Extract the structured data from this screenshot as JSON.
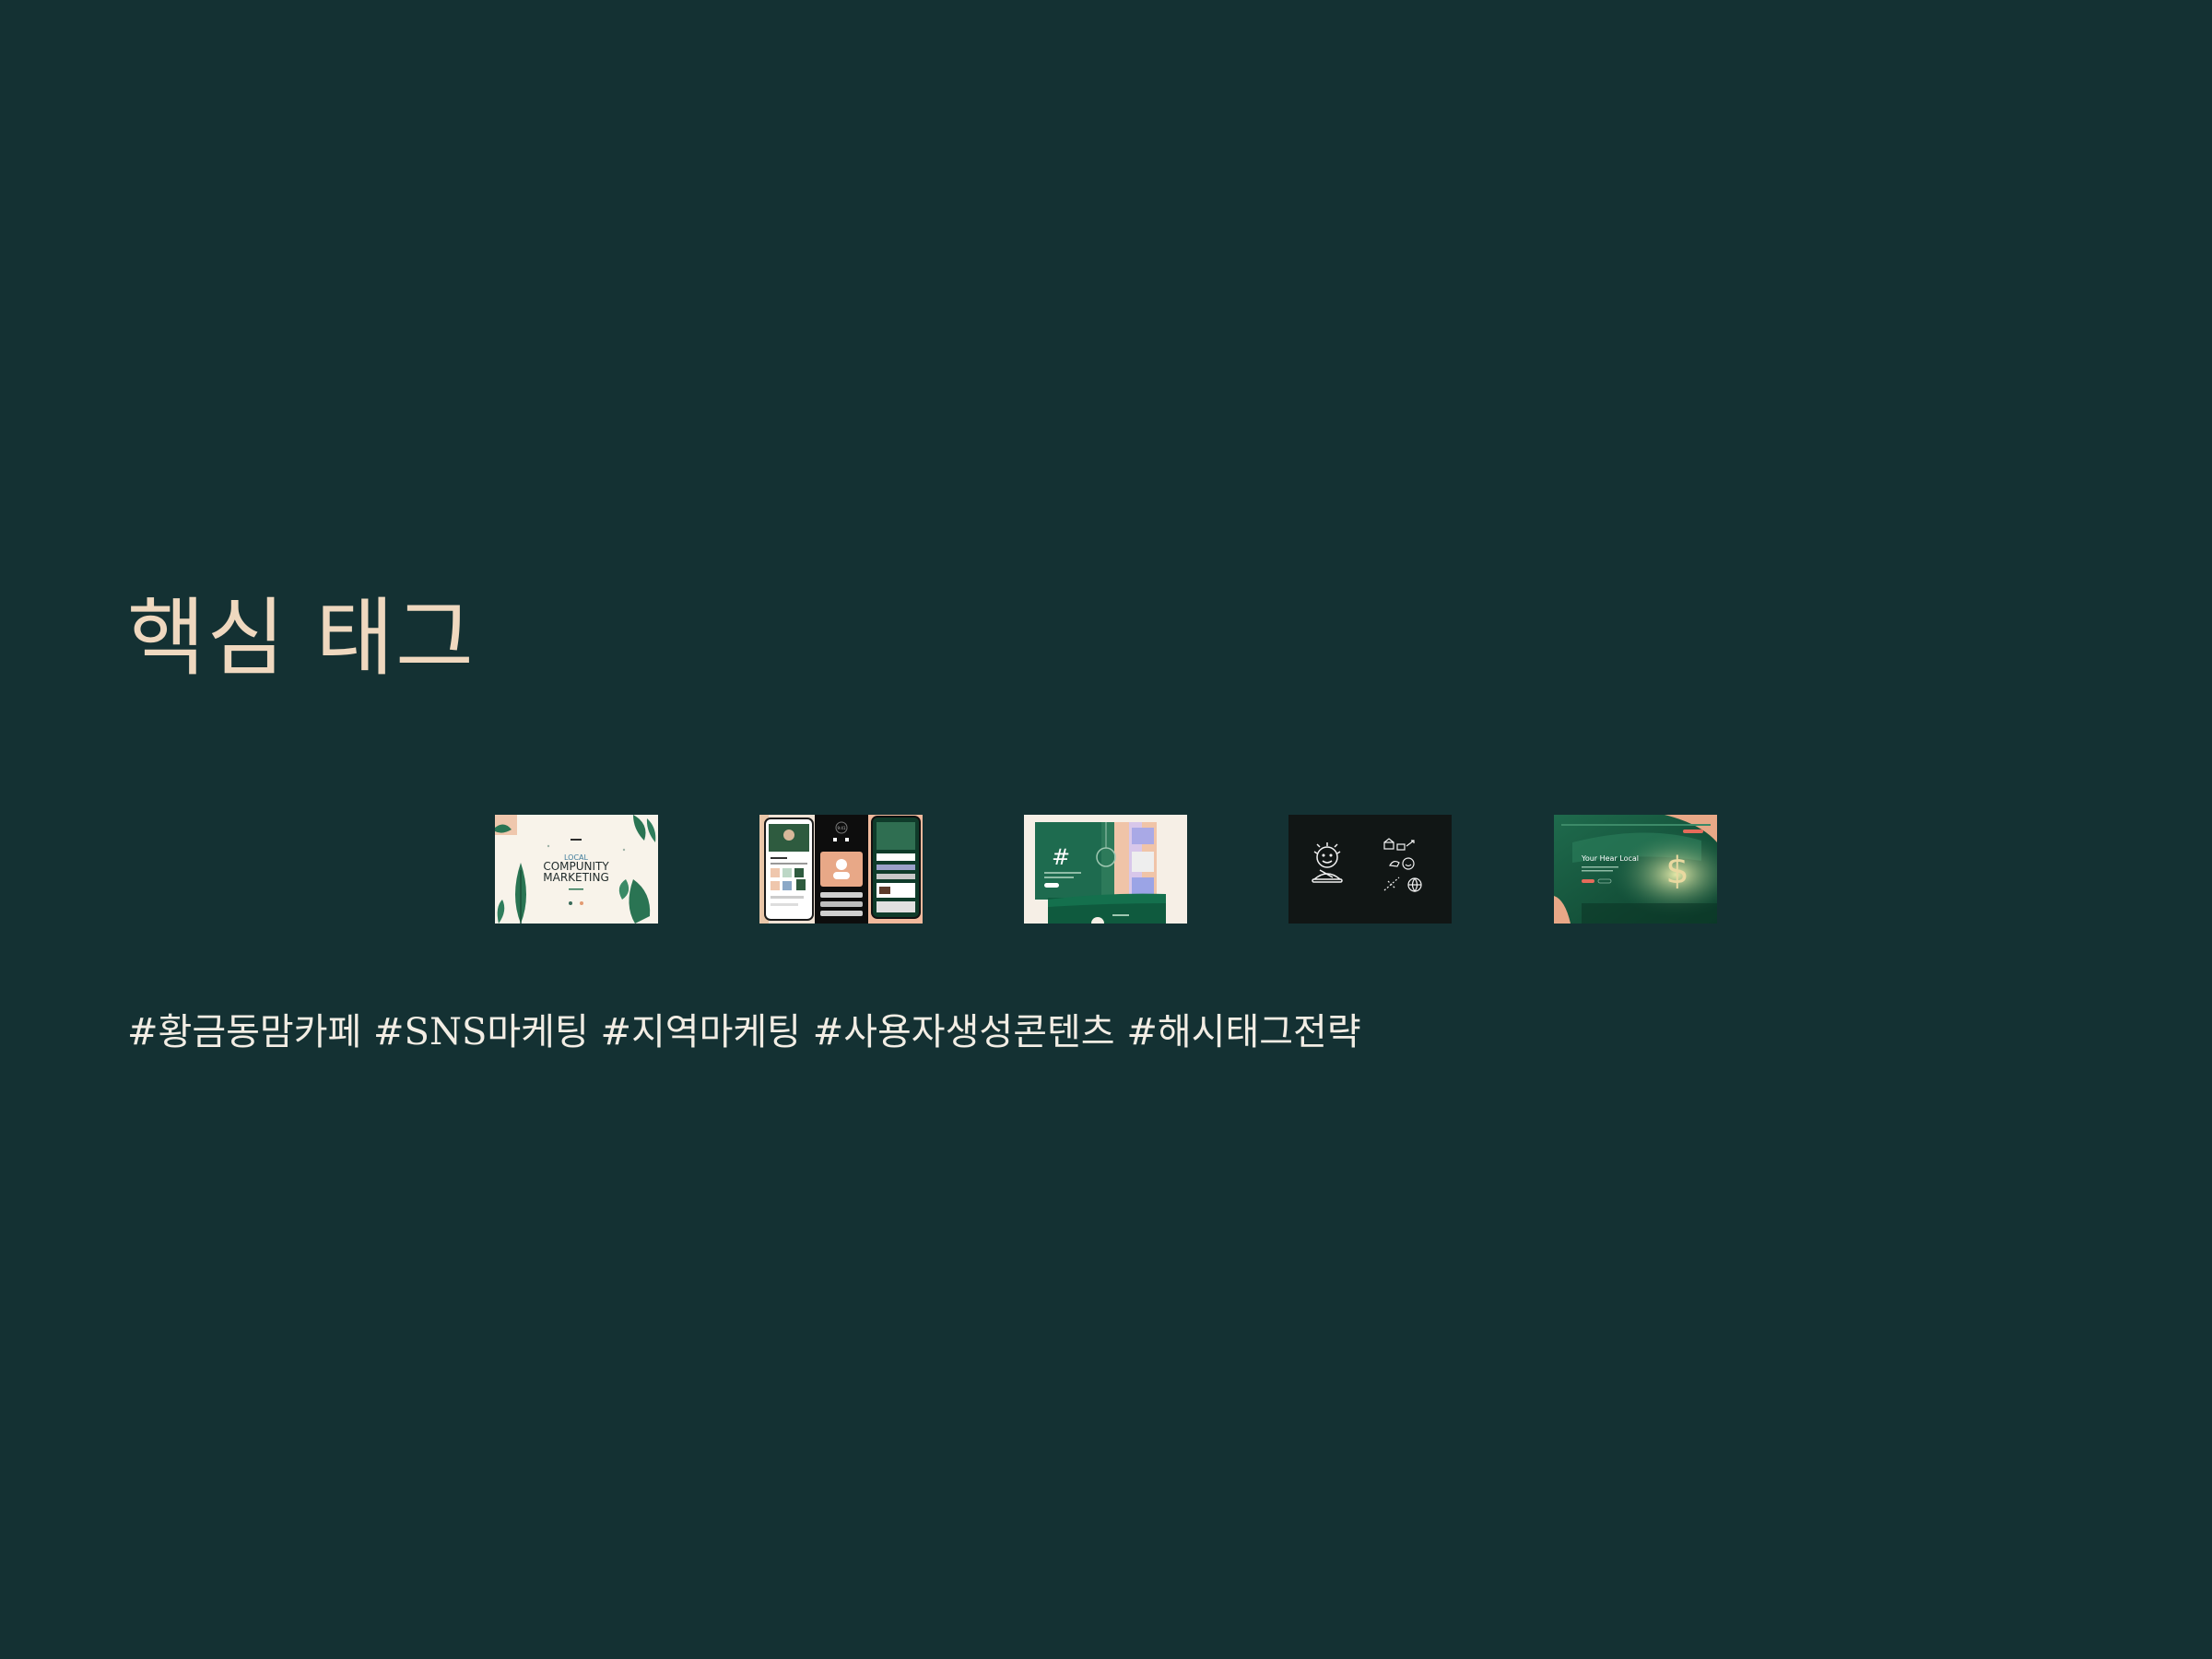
{
  "slide": {
    "title": "핵심 태그",
    "tags": "#황금동맘카페 #SNS마케팅 #지역마케팅 #사용자생성콘텐츠 #해시태그전략",
    "colors": {
      "background": "#143133",
      "title": "#efd8bf",
      "tags": "#f2ede4",
      "accent_green": "#1e6b4f",
      "accent_peach": "#e8a887"
    }
  },
  "thumbnails": {
    "one": {
      "line1": "LOCAL",
      "line2": "COMPUNITY",
      "line3": "MARKETING"
    },
    "two": {
      "clock": "9:41"
    },
    "three": {
      "hash": "#"
    },
    "four": {
      "icon": "sun-face-icon"
    },
    "five": {
      "headline": "Your Hear Local",
      "symbol": "$"
    }
  }
}
